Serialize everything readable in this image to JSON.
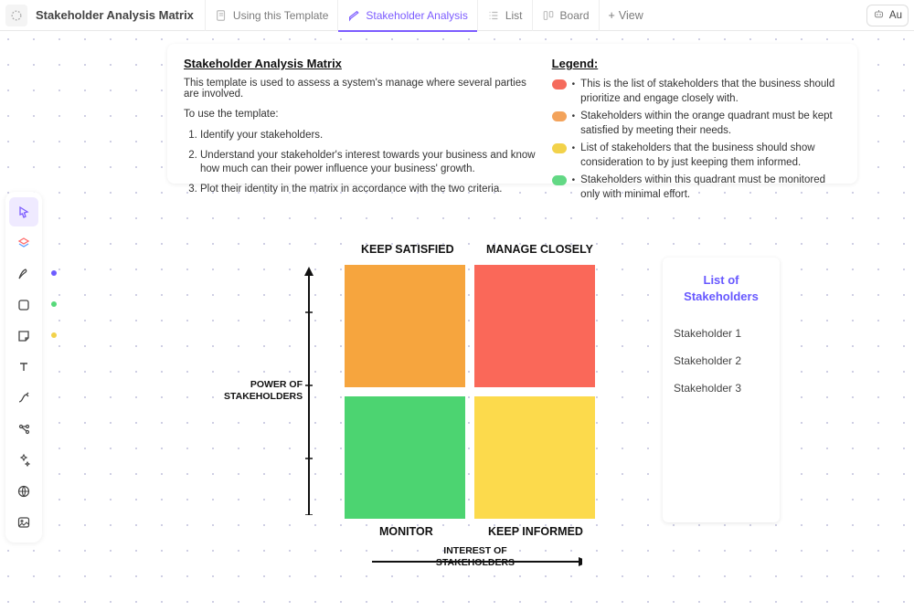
{
  "header": {
    "title": "Stakeholder Analysis Matrix",
    "tabs": {
      "using": "Using this Template",
      "analysis": "Stakeholder Analysis",
      "list": "List",
      "board": "Board"
    },
    "add_view": "View",
    "aut": "Au"
  },
  "info": {
    "title": "Stakeholder Analysis Matrix",
    "description": "This template is used to assess a system's manage where several parties are involved.",
    "instructions_heading": "To use the template:",
    "steps": {
      "s1": "Identify your stakeholders.",
      "s2": "Understand your stakeholder's interest towards your business and know how much can their power influence your business' growth.",
      "s3": "Plot their identity in the matrix in accordance with the two criteria."
    },
    "legend_title": "Legend:",
    "legend": {
      "red": "This is the list of stakeholders that the business should prioritize and engage closely with.",
      "orange": "Stakeholders within the orange quadrant must be kept satisfied by meeting their needs.",
      "yellow": "List of stakeholders that the business should show consideration to by just keeping them informed.",
      "green": "Stakeholders within this quadrant must be monitored only with minimal effort."
    }
  },
  "matrix": {
    "top_left": "KEEP SATISFIED",
    "top_right": "MANAGE CLOSELY",
    "bottom_left": "MONITOR",
    "bottom_right": "KEEP INFORMED",
    "y_axis_top": "POWER OF",
    "y_axis_bottom": "STAKEHOLDERS",
    "x_axis_top": "INTEREST OF",
    "x_axis_bottom": "STAKEHOLDERS",
    "colors": {
      "tl": "#f6a53e",
      "tr": "#fa6859",
      "bl": "#4cd471",
      "br": "#fcda4c"
    }
  },
  "stakeholders": {
    "title": "List of Stakeholders",
    "items": {
      "i1": "Stakeholder 1",
      "i2": "Stakeholder 2",
      "i3": "Stakeholder 3"
    }
  }
}
